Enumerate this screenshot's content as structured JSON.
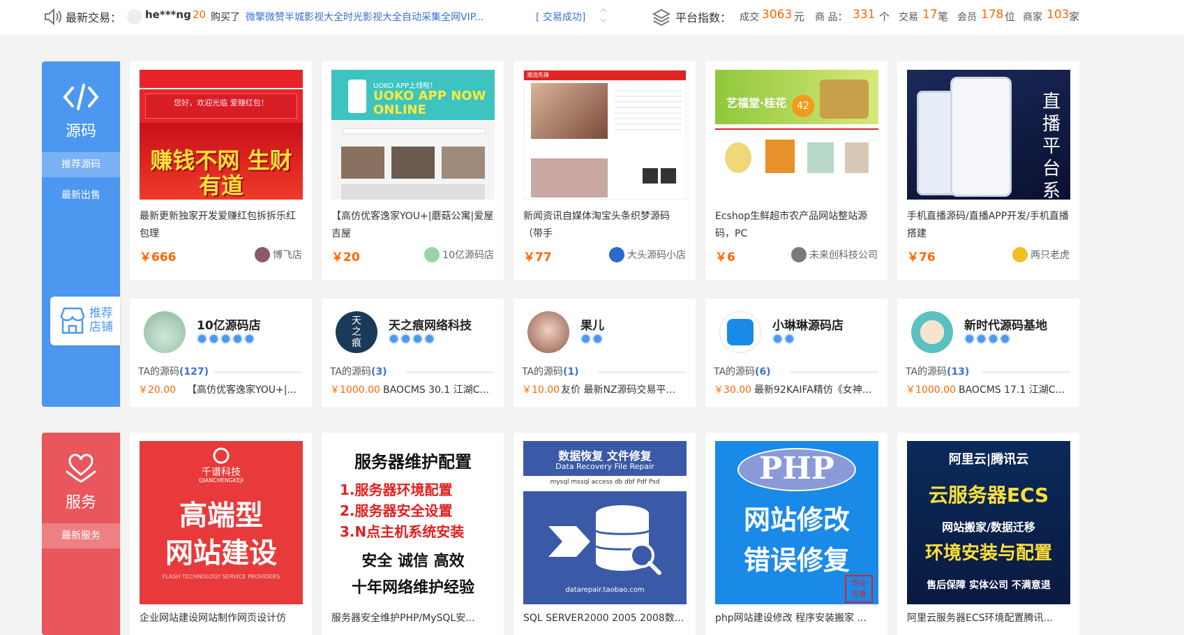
{
  "topbar": {
    "latest_label": "最新交易：",
    "buyer": "he***ng",
    "buyer_qty": "20",
    "bought_text": "购买了",
    "product": "微擎微赞半城影视大全时光影视大全自动采集全网VIP...",
    "status": "[ 交易成功]",
    "index_label": "平台指数：",
    "stat_deal_label": "成交",
    "stat_deal_value": "3063",
    "stat_deal_unit": "元",
    "stat_goods_label": "商 品：",
    "stat_goods_value": "331",
    "stat_goods_unit": "个",
    "stat_trade_label": "交易",
    "stat_trade_value": "17",
    "stat_trade_unit": "笔",
    "stat_member_label": "会员",
    "stat_member_value": "178",
    "stat_member_unit": "位",
    "stat_shop_label": "商家",
    "stat_shop_value": "103",
    "stat_shop_unit": "家"
  },
  "source_cat": {
    "title": "源码",
    "link_recommend": "推荐源码",
    "link_latest": "最新出售",
    "rec_shop": "推荐店铺",
    "color": "#4c98f0"
  },
  "service_cat": {
    "title": "服务",
    "link_latest": "最新服务",
    "color": "#e9565b"
  },
  "products": [
    {
      "title": "最新更新独家开发爱赚红包拆拆乐红包理",
      "price": "￥666",
      "shop": "博飞店",
      "thumb_text": "赚钱不网 生财有道",
      "thumb_top": "您好，欢迎光临 爱赚红包！"
    },
    {
      "title": "【高仿优客逸家YOU+|蘑菇公寓|爱屋吉屋",
      "price": "￥20",
      "shop": "10亿源码店",
      "thumb_text": "UOKO APP NOW ONLINE",
      "thumb_top": "UOKO APP上线啦！"
    },
    {
      "title": "新闻资讯自媒体淘宝头条织梦源码（带手",
      "price": "￥77",
      "shop": "大头源码小店",
      "thumb_text": "",
      "thumb_top": "潮流先锋"
    },
    {
      "title": "Ecshop生鲜超市农产品网站整站源码，PC",
      "price": "￥6",
      "shop": "未来创科技公司",
      "thumb_text": "艺福堂·桂花",
      "thumb_top": "42"
    },
    {
      "title": "手机直播源码/直播APP开发/手机直播搭建",
      "price": "￥76",
      "shop": "两只老虎",
      "thumb_text": "直播平台系统",
      "thumb_top": ""
    }
  ],
  "shops": [
    {
      "name": "10亿源码店",
      "badges": 5,
      "ta_label": "TA的源码",
      "count": "(127)",
      "price": "￥20.00",
      "latest": "【高仿优客逸家YOU+|..."
    },
    {
      "name": "天之痕网络科技",
      "badges": 4,
      "ta_label": "TA的源码",
      "count": "(3)",
      "price": "￥1000.00",
      "latest": "BAOCMS 30.1 江湖C...",
      "avatar_text": "天之痕"
    },
    {
      "name": "果儿",
      "badges": 2,
      "ta_label": "TA的源码",
      "count": "(1)",
      "price": "￥10.00",
      "latest": "友价 最新NZ源码交易平..."
    },
    {
      "name": "小琳琳源码店",
      "badges": 2,
      "ta_label": "TA的源码",
      "count": "(6)",
      "price": "￥30.00",
      "latest": "最新92KAIFA精仿《女神..."
    },
    {
      "name": "新时代源码基地",
      "badges": 4,
      "ta_label": "TA的源码",
      "count": "(13)",
      "price": "￥1000.00",
      "latest": "BAOCMS 17.1 江湖C..."
    }
  ],
  "services": [
    {
      "title": "企业网站建设网站制作网页设计仿",
      "brand": "千谱科技",
      "brand_en": "QIANCHENGKEJI",
      "line1": "高端型",
      "line2": "网站建设",
      "foot": "FLASH TECHNOLOGY SERVICE PROVIDERS"
    },
    {
      "title": "服务器安全维护PHP/MySQL安...",
      "head": "服务器维护配置",
      "l1": "1.服务器环境配置",
      "l2": "2.服务器安全设置",
      "l3": "3.N点主机系统安装",
      "l4": "安全 诚信 高效",
      "l5": "十年网络维护经验"
    },
    {
      "title": "SQL SERVER2000 2005 2008数...",
      "h1": "数据恢复 文件修复",
      "h2": "Data Recovery File Repair",
      "h3": "mysql mssql access db dbf Pdf Psd",
      "site": "datarepair.taobao.com"
    },
    {
      "title": "php网站建设修改 程序安装搬家 ...",
      "php": "PHP",
      "l1": "网站修改",
      "l2": "错误修复",
      "stamp": "专业可靠"
    },
    {
      "title": "阿里云服务器ECS环境配置腾讯...",
      "logos": "阿里云|腾讯云",
      "l1": "云服务器ECS",
      "l2": "网站搬家/数据迁移",
      "l3": "环境安装与配置",
      "l4": "售后保障 实体公司 不满意退"
    }
  ]
}
